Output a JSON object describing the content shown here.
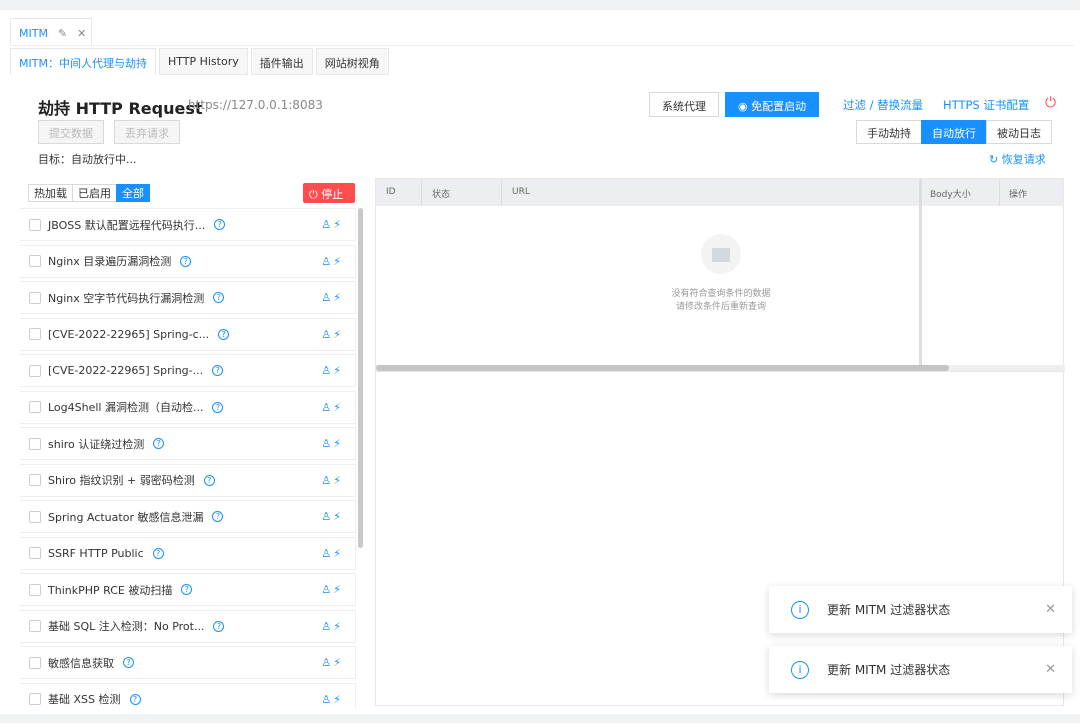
{
  "tab": {
    "label": "MITM",
    "edit_icon": "✎",
    "close_icon": "✕"
  },
  "subtabs": [
    "MITM：中间人代理与劫持",
    "HTTP History",
    "插件输出",
    "网站树视角"
  ],
  "header": {
    "title": "劫持 HTTP Request",
    "url": "https://127.0.0.1:8083",
    "submit": "提交数据",
    "discard": "丢弃请求",
    "target": "目标：自动放行中..."
  },
  "toolbar": {
    "system_proxy": "系统代理",
    "free_start": "免配置启动",
    "filter": "过滤 / 替换流量",
    "https_cert": "HTTPS 证书配置",
    "modes": [
      "手动劫持",
      "自动放行",
      "被动日志"
    ],
    "restore": "恢复请求"
  },
  "plugins": {
    "filters": [
      "热加载",
      "已启用",
      "全部"
    ],
    "stop": "停止",
    "items": [
      "JBOSS 默认配置远程代码执行...",
      "Nginx 目录遍历漏洞检测",
      "Nginx 空字节代码执行漏洞检测",
      "[CVE-2022-22965] Spring-c...",
      "[CVE-2022-22965] Spring-...",
      "Log4Shell 漏洞检测（自动检...",
      "shiro 认证绕过检测",
      "Shiro 指纹识别 + 弱密码检测",
      "Spring Actuator 敏感信息泄漏",
      "SSRF HTTP Public",
      "ThinkPHP RCE 被动扫描",
      "基础 SQL 注入检测：No Prot...",
      "敏感信息获取",
      "基础 XSS 检测"
    ]
  },
  "table": {
    "columns": [
      "ID",
      "状态",
      "URL",
      "Body大小",
      "操作"
    ],
    "empty1": "没有符合查询条件的数据",
    "empty2": "请修改条件后重新查询"
  },
  "notifications": [
    "更新 MITM 过滤器状态",
    "更新 MITM 过滤器状态"
  ],
  "colors": {
    "accent": "#1890ff",
    "danger": "#ff4d4f"
  }
}
